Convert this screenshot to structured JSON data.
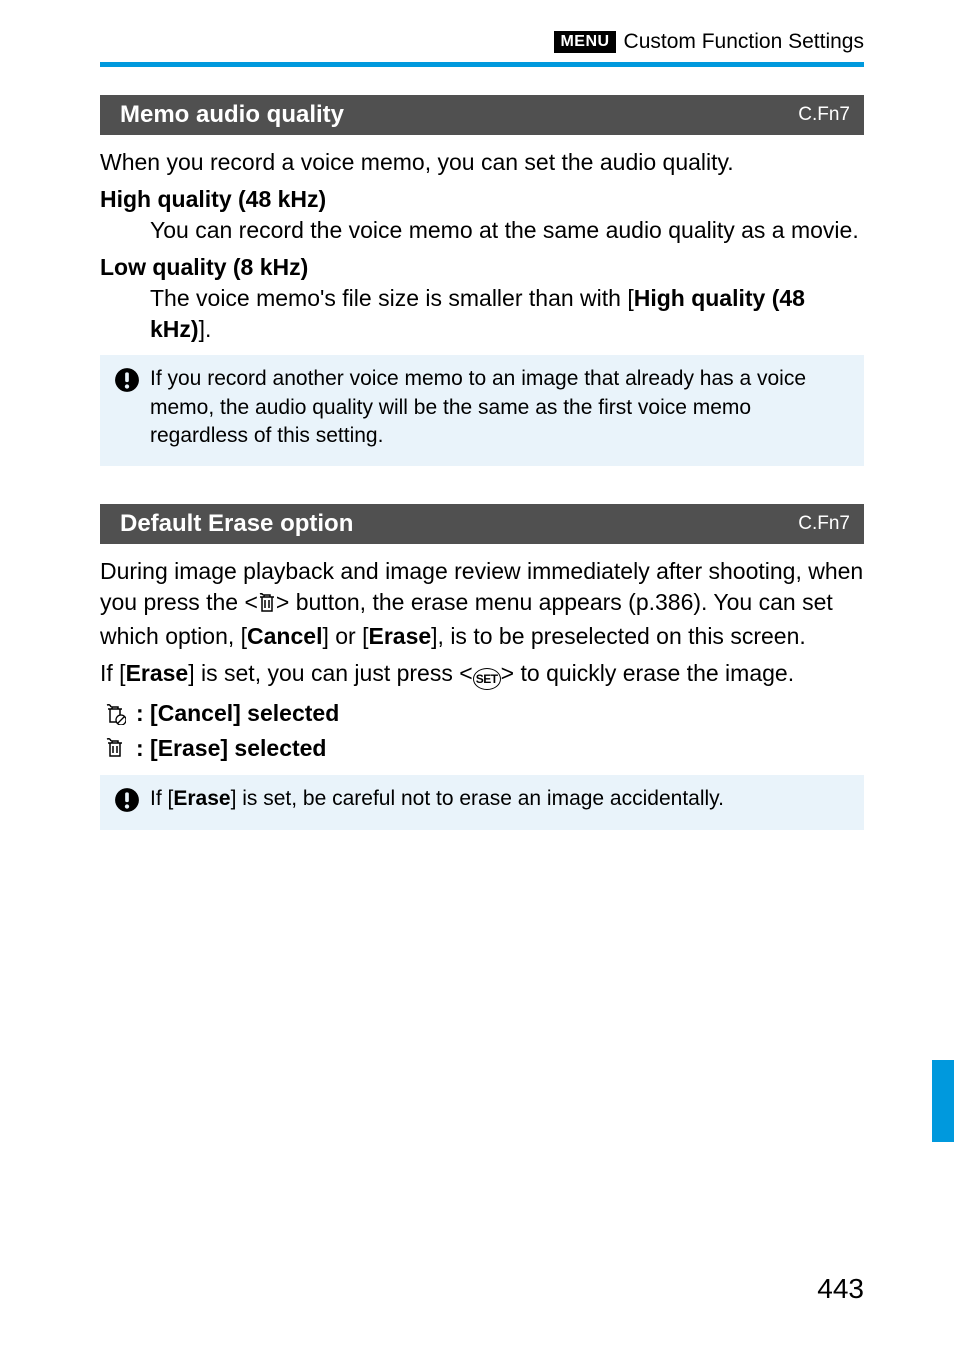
{
  "header": {
    "menu_badge": "MENU",
    "header_text": "Custom Function Settings"
  },
  "section1": {
    "title": "Memo audio quality",
    "cfn": "C.Fn7",
    "intro": "When you record a voice memo, you can set the audio quality.",
    "opt1_title": "High quality (48 kHz)",
    "opt1_body": "You can record the voice memo at the same audio quality as a movie.",
    "opt2_title": "Low quality (8 kHz)",
    "opt2_body_pre": "The voice memo's file size is smaller than with [",
    "opt2_body_bold": "High quality (48 kHz)",
    "opt2_body_post": "].",
    "note": "If you record another voice memo to an image that already has a voice memo, the audio quality will be the same as the first voice memo regardless of this setting."
  },
  "section2": {
    "title": "Default Erase option",
    "cfn": "C.Fn7",
    "para1_a": "During image playback and image review immediately after shooting, when you press the <",
    "para1_b": "> button, the erase menu appears (p.386). You can set which option, [",
    "para1_cancel": "Cancel",
    "para1_c": "] or [",
    "para1_erase": "Erase",
    "para1_d": "], is to be preselected on this screen.",
    "para2_a": "If [",
    "para2_erase": "Erase",
    "para2_b": "] is set, you can just press <",
    "para2_set": "SET",
    "para2_c": "> to quickly erase the image.",
    "opt_cancel": ": [Cancel] selected",
    "opt_erase": ": [Erase] selected",
    "note_a": "If [",
    "note_erase": "Erase",
    "note_b": "] is set, be careful not to erase an image accidentally."
  },
  "page_number": "443"
}
